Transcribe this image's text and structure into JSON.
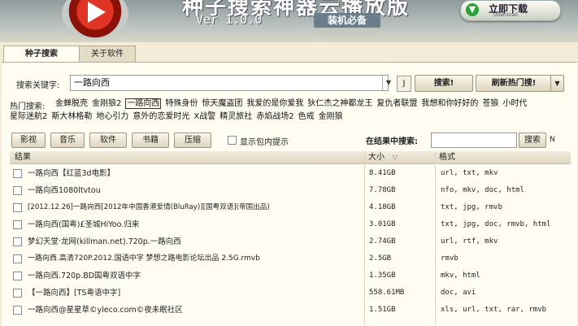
{
  "header": {
    "app_title": "种子搜索神器云播放版",
    "version": "Ver 1.0.0",
    "badge": "装机必备",
    "download_label": "立即下载",
    "download_sub": "Download"
  },
  "tabs": [
    {
      "label": "种子搜索"
    },
    {
      "label": "关于软件"
    }
  ],
  "search": {
    "label": "搜索关键字:",
    "value": "一路向西",
    "j_label": "J",
    "search_button": "搜索!",
    "refresh_button": "刷新热门搜!"
  },
  "hot": {
    "label": "热门搜索:",
    "items": [
      "金蝉脱壳",
      "金刚狼2",
      "一路向西",
      "特殊身份",
      "惊天魔盗团",
      "我爱的是你爱我",
      "狄仁杰之神都龙王",
      "复仇者联盟",
      "我想和你好好的",
      "苍狼",
      "小时代",
      "星际迷航2",
      "斯大林格勒",
      "地心引力",
      "意外的恋爱时光",
      "X战警",
      "精灵旅社",
      "赤焰战场2",
      "色戒",
      "金刚狼"
    ],
    "selected_index": 2
  },
  "filters": {
    "buttons": [
      "影视",
      "音乐",
      "软件",
      "书籍",
      "压缩"
    ],
    "show_inner_label": "显示包内提示",
    "in_result_label": "在结果中搜索:",
    "in_result_value": "",
    "in_result_button": "搜索",
    "n_label": "N"
  },
  "table": {
    "columns": [
      "结果",
      "大小",
      "格式"
    ],
    "rows": [
      {
        "name": "一路向西【红蓝3d电影】",
        "size": "8.41GB",
        "format": "url, txt, mkv"
      },
      {
        "name": "一路向西1080ltvtou",
        "size": "7.78GB",
        "format": "nfo, mkv, doc, html"
      },
      {
        "name": "[2012.12.26]一路向西[2012年中国香港爱情(BluRay)][国粤双语](帝国出品)",
        "size": "4.18GB",
        "format": "txt, jpg, rmvb"
      },
      {
        "name": "一路向西(国粤)£圣城HiYoo.归来",
        "size": "3.01GB",
        "format": "txt, jpg, doc, rmvb, html"
      },
      {
        "name": "梦幻天堂·龙网(killman.net).720p.一路向西",
        "size": "2.74GB",
        "format": "url, rtf, mkv"
      },
      {
        "name": "一路向西.高清720P.2012.国语中字 梦想之路电影论坛出品 2.5G.rmvb",
        "size": "2.5GB",
        "format": "rmvb"
      },
      {
        "name": "一路向西.720p.BD国粤双语中字",
        "size": "1.35GB",
        "format": "mkv, html"
      },
      {
        "name": "【一路向西】[TS粤语中字]",
        "size": "558.61MB",
        "format": "doc, avi"
      },
      {
        "name": "一路向西@星星草©yleco.com©夜未眠社区",
        "size": "1.51GB",
        "format": "xls, url, txt, rar, rmvb"
      }
    ]
  }
}
